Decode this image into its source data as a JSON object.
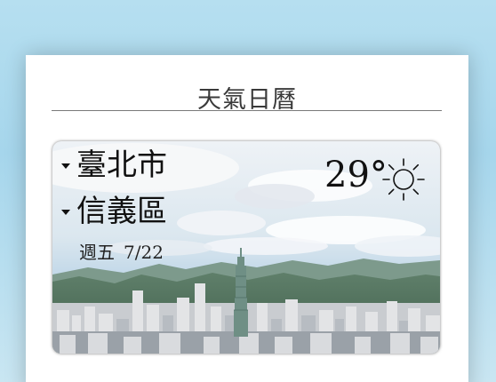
{
  "app": {
    "title": "天氣日曆"
  },
  "weather": {
    "city": "臺北市",
    "district": "信義區",
    "weekday": "週五",
    "date": "7/22",
    "temperature": "29°",
    "condition_icon": "sun-icon"
  },
  "colors": {
    "page_background": "#a6d6ec",
    "card_background": "#ffffff",
    "text_dark": "#111111"
  }
}
